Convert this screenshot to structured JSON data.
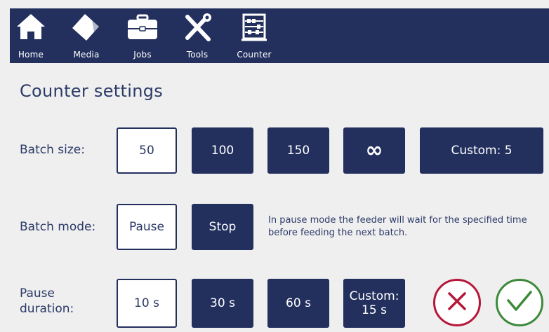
{
  "nav": {
    "items": [
      {
        "label": "Home",
        "icon": "home-icon"
      },
      {
        "label": "Media",
        "icon": "media-icon"
      },
      {
        "label": "Jobs",
        "icon": "jobs-icon"
      },
      {
        "label": "Tools",
        "icon": "tools-icon"
      },
      {
        "label": "Counter",
        "icon": "counter-icon"
      }
    ]
  },
  "page": {
    "title": "Counter settings"
  },
  "batch_size": {
    "label": "Batch size:",
    "options": [
      "50",
      "100",
      "150",
      "∞",
      "Custom: 5"
    ],
    "selected": "50"
  },
  "batch_mode": {
    "label": "Batch mode:",
    "options": [
      "Pause",
      "Stop"
    ],
    "selected": "Pause",
    "note": "In pause mode the feeder will wait for the specified time before feeding the next batch."
  },
  "pause_duration": {
    "label_line1": "Pause",
    "label_line2": "duration:",
    "options": [
      "10 s",
      "30 s",
      "60 s"
    ],
    "custom_line1": "Custom:",
    "custom_line2": "15 s",
    "selected": "10 s"
  },
  "actions": {
    "cancel_icon": "close-icon",
    "confirm_icon": "check-icon"
  },
  "colors": {
    "navy": "#23305e",
    "text": "#2b3a67",
    "background": "#efefef",
    "cancel": "#b5183a",
    "confirm": "#3d8a3a"
  }
}
